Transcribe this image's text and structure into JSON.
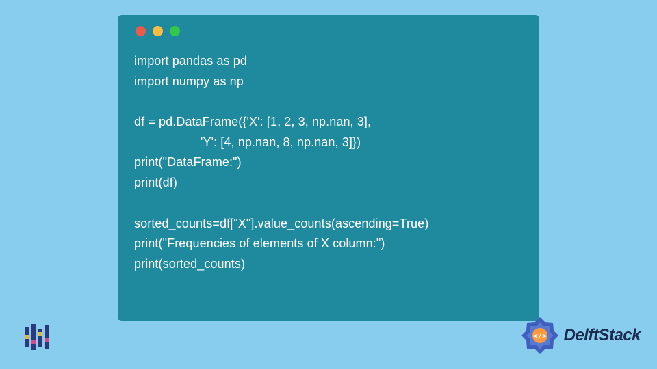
{
  "code": {
    "lines": [
      "import pandas as pd",
      "import numpy as np",
      "",
      "df = pd.DataFrame({'X': [1, 2, 3, np.nan, 3],",
      "                   'Y': [4, np.nan, 8, np.nan, 3]})",
      "print(\"DataFrame:\")",
      "print(df)",
      "",
      "sorted_counts=df[\"X\"].value_counts(ascending=True)",
      "print(\"Frequencies of elements of X column:\")",
      "print(sorted_counts)"
    ]
  },
  "brand": {
    "name": "DelftStack"
  },
  "colors": {
    "page_bg": "#88ccee",
    "window_bg": "#1f8a9e",
    "code_text": "#ffffff",
    "brand_text": "#1b2a4e",
    "badge_primary": "#3f5fbf",
    "badge_accent": "#ff9a3c"
  }
}
